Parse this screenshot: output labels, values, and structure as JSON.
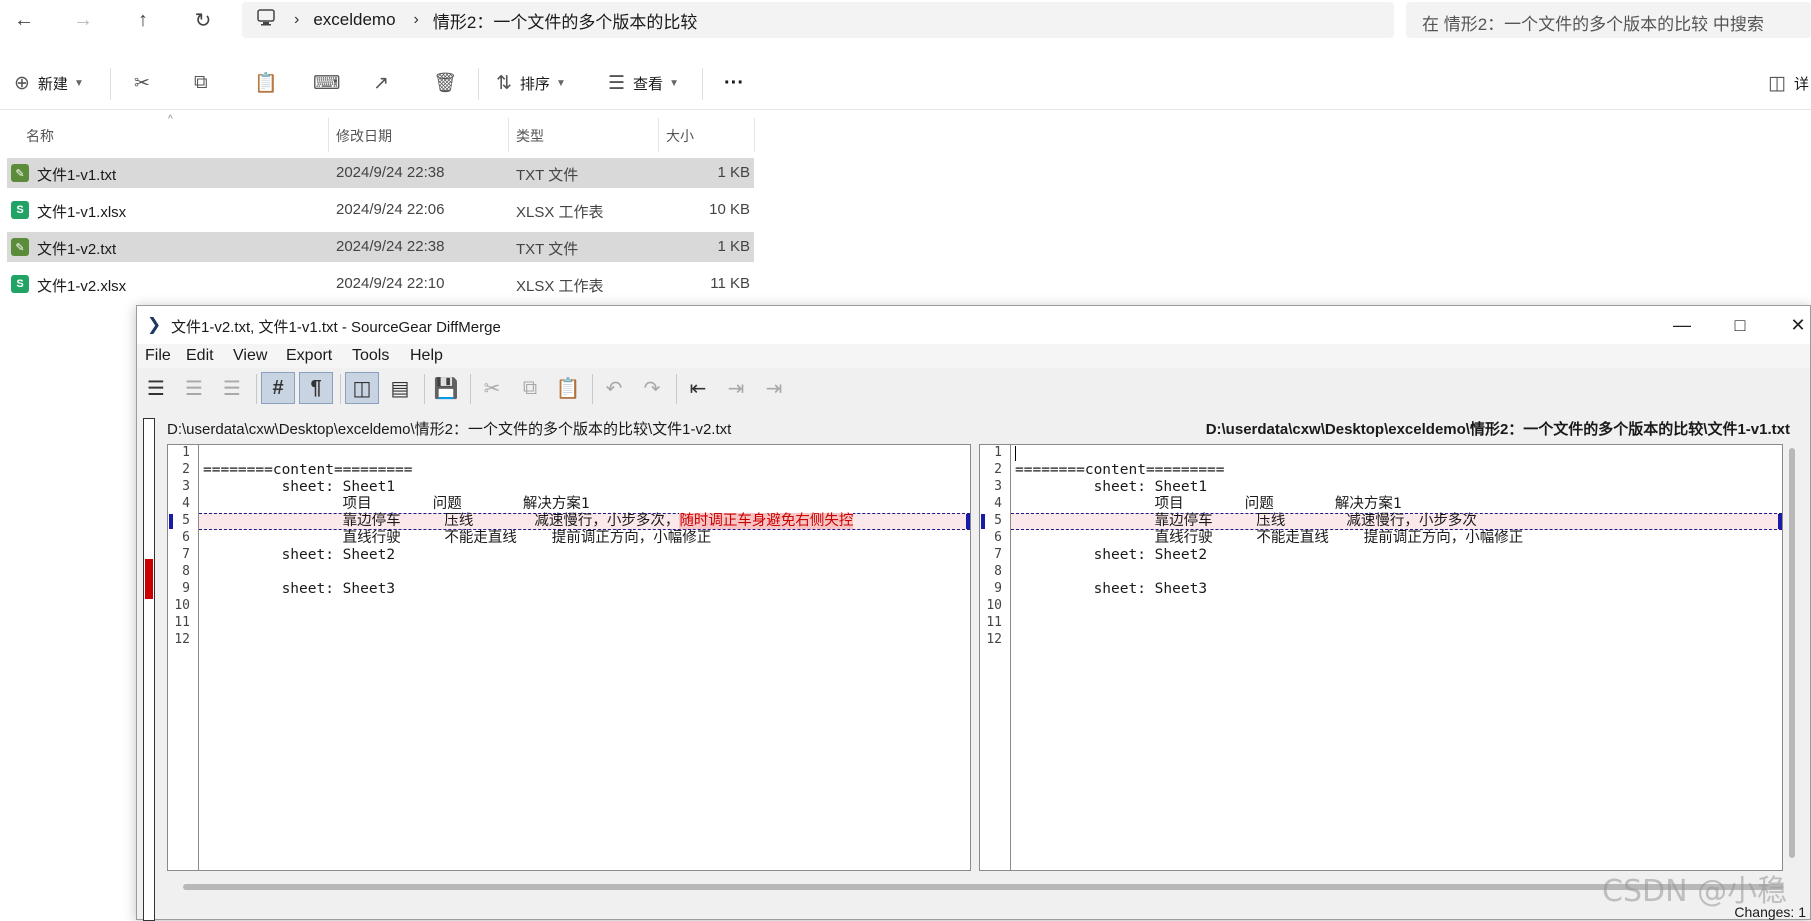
{
  "explorer": {
    "nav": {
      "back_icon": "arrow-left-icon",
      "forward_icon": "arrow-right-icon",
      "up_icon": "arrow-up-icon",
      "refresh_icon": "refresh-icon"
    },
    "breadcrumbs": [
      "exceldemo",
      "情形2：一个文件的多个版本的比较"
    ],
    "search_placeholder": "在 情形2：一个文件的多个版本的比较 中搜索",
    "commands": {
      "new_label": "新建",
      "sort_label": "排序",
      "view_label": "查看",
      "more_label": "···",
      "details_label": "详"
    },
    "columns": [
      "名称",
      "修改日期",
      "类型",
      "大小"
    ],
    "files": [
      {
        "name": "文件1-v1.txt",
        "date": "2024/9/24 22:38",
        "type": "TXT 文件",
        "size": "1 KB",
        "selected": true,
        "kind": "txt"
      },
      {
        "name": "文件1-v1.xlsx",
        "date": "2024/9/24 22:06",
        "type": "XLSX 工作表",
        "size": "10 KB",
        "selected": false,
        "kind": "xlsx"
      },
      {
        "name": "文件1-v2.txt",
        "date": "2024/9/24 22:38",
        "type": "TXT 文件",
        "size": "1 KB",
        "selected": true,
        "kind": "txt"
      },
      {
        "name": "文件1-v2.xlsx",
        "date": "2024/9/24 22:10",
        "type": "XLSX 工作表",
        "size": "11 KB",
        "selected": false,
        "kind": "xlsx"
      }
    ]
  },
  "diffmerge": {
    "title": "文件1-v2.txt, 文件1-v1.txt - SourceGear DiffMerge",
    "menu": [
      "File",
      "Edit",
      "View",
      "Export",
      "Tools",
      "Help"
    ],
    "left_path": "D:\\userdata\\cxw\\Desktop\\exceldemo\\情形2：一个文件的多个版本的比较\\文件1-v2.txt",
    "right_path": "D:\\userdata\\cxw\\Desktop\\exceldemo\\情形2：一个文件的多个版本的比较\\文件1-v1.txt",
    "line_numbers": [
      "1",
      "2",
      "3",
      "4",
      "5",
      "6",
      "7",
      "8",
      "9",
      "10",
      "11",
      "12"
    ],
    "left_lines": [
      "",
      "========content=========",
      "         sheet: Sheet1",
      "                项目       问题       解决方案1",
      "                靠边停车     压线       减速慢行，小步多次，",
      "                直线行驶     不能走直线    提前调正方向，小幅修正",
      "         sheet: Sheet2",
      "",
      "         sheet: Sheet3",
      "",
      "",
      ""
    ],
    "left_line5_added": "随时调正车身避免右侧失控",
    "right_lines": [
      "",
      "========content=========",
      "         sheet: Sheet1",
      "                项目       问题       解决方案1",
      "                靠边停车     压线       减速慢行，小步多次",
      "                直线行驶     不能走直线    提前调正方向，小幅修正",
      "         sheet: Sheet2",
      "",
      "         sheet: Sheet3",
      "",
      "",
      ""
    ],
    "status": "Changes: 1"
  },
  "watermark": "CSDN @小稳"
}
